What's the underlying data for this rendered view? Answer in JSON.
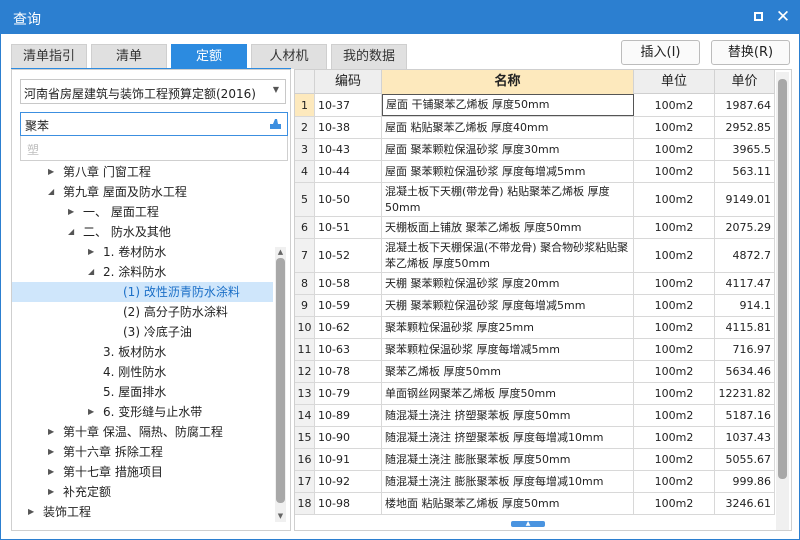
{
  "window": {
    "title": "查询"
  },
  "tabs": [
    {
      "label": "清单指引"
    },
    {
      "label": "清单"
    },
    {
      "label": "定额",
      "active": true
    },
    {
      "label": "人材机"
    },
    {
      "label": "我的数据"
    }
  ],
  "toolbar": {
    "insert_label": "插入(I)",
    "replace_label": "替换(R)"
  },
  "library": {
    "selected": "河南省房屋建筑与装饰工程预算定额(2016)"
  },
  "search": {
    "value": "聚苯",
    "suggestion": "塑"
  },
  "tree": [
    {
      "label": "第八章 门窗工程",
      "level": 0,
      "expanded": false
    },
    {
      "label": "第九章 屋面及防水工程",
      "level": 0,
      "expanded": true
    },
    {
      "label": "一、 屋面工程",
      "level": 1,
      "expanded": false
    },
    {
      "label": "二、 防水及其他",
      "level": 1,
      "expanded": true
    },
    {
      "label": "1. 卷材防水",
      "level": 2,
      "expanded": false
    },
    {
      "label": "2. 涂料防水",
      "level": 2,
      "expanded": true
    },
    {
      "label": "(1) 改性沥青防水涂料",
      "level": 3,
      "selected": true
    },
    {
      "label": "(2) 高分子防水涂料",
      "level": 3
    },
    {
      "label": "(3) 冷底子油",
      "level": 3
    },
    {
      "label": "3. 板材防水",
      "level": 2
    },
    {
      "label": "4. 刚性防水",
      "level": 2
    },
    {
      "label": "5. 屋面排水",
      "level": 2
    },
    {
      "label": "6. 变形缝与止水带",
      "level": 2,
      "expanded": false
    },
    {
      "label": "第十章 保温、隔热、防腐工程",
      "level": 0,
      "expanded": false
    },
    {
      "label": "第十六章 拆除工程",
      "level": 0,
      "expanded": false
    },
    {
      "label": "第十七章 措施项目",
      "level": 0,
      "expanded": false
    },
    {
      "label": "补充定额",
      "level": 0,
      "expanded": false
    },
    {
      "label": "装饰工程",
      "level": -1,
      "expanded": false
    }
  ],
  "grid": {
    "headers": {
      "code": "编码",
      "name": "名称",
      "unit": "单位",
      "price": "单价"
    },
    "rows": [
      {
        "no": "1",
        "code": "10-37",
        "name": "屋面 干铺聚苯乙烯板 厚度50mm",
        "unit": "100m2",
        "price": "1987.64"
      },
      {
        "no": "2",
        "code": "10-38",
        "name": "屋面 粘贴聚苯乙烯板 厚度40mm",
        "unit": "100m2",
        "price": "2952.85"
      },
      {
        "no": "3",
        "code": "10-43",
        "name": "屋面 聚苯颗粒保温砂浆 厚度30mm",
        "unit": "100m2",
        "price": "3965.5"
      },
      {
        "no": "4",
        "code": "10-44",
        "name": "屋面 聚苯颗粒保温砂浆 厚度每增减5mm",
        "unit": "100m2",
        "price": "563.11"
      },
      {
        "no": "5",
        "code": "10-50",
        "name": "混凝土板下天棚(带龙骨) 粘贴聚苯乙烯板 厚度50mm",
        "unit": "100m2",
        "price": "9149.01"
      },
      {
        "no": "6",
        "code": "10-51",
        "name": "天棚板面上铺放 聚苯乙烯板 厚度50mm",
        "unit": "100m2",
        "price": "2075.29"
      },
      {
        "no": "7",
        "code": "10-52",
        "name": "混凝土板下天棚保温(不带龙骨) 聚合物砂浆粘贴聚苯乙烯板 厚度50mm",
        "unit": "100m2",
        "price": "4872.7"
      },
      {
        "no": "8",
        "code": "10-58",
        "name": "天棚 聚苯颗粒保温砂浆 厚度20mm",
        "unit": "100m2",
        "price": "4117.47"
      },
      {
        "no": "9",
        "code": "10-59",
        "name": "天棚 聚苯颗粒保温砂浆 厚度每增减5mm",
        "unit": "100m2",
        "price": "914.1"
      },
      {
        "no": "10",
        "code": "10-62",
        "name": "聚苯颗粒保温砂浆 厚度25mm",
        "unit": "100m2",
        "price": "4115.81"
      },
      {
        "no": "11",
        "code": "10-63",
        "name": "聚苯颗粒保温砂浆 厚度每增减5mm",
        "unit": "100m2",
        "price": "716.97"
      },
      {
        "no": "12",
        "code": "10-78",
        "name": "聚苯乙烯板 厚度50mm",
        "unit": "100m2",
        "price": "5634.46"
      },
      {
        "no": "13",
        "code": "10-79",
        "name": "单面钢丝网聚苯乙烯板 厚度50mm",
        "unit": "100m2",
        "price": "12231.82"
      },
      {
        "no": "14",
        "code": "10-89",
        "name": "随混凝土浇注 挤塑聚苯板 厚度50mm",
        "unit": "100m2",
        "price": "5187.16"
      },
      {
        "no": "15",
        "code": "10-90",
        "name": "随混凝土浇注 挤塑聚苯板 厚度每增减10mm",
        "unit": "100m2",
        "price": "1037.43"
      },
      {
        "no": "16",
        "code": "10-91",
        "name": "随混凝土浇注 膨胀聚苯板 厚度50mm",
        "unit": "100m2",
        "price": "5055.67"
      },
      {
        "no": "17",
        "code": "10-92",
        "name": "随混凝土浇注 膨胀聚苯板 厚度每增减10mm",
        "unit": "100m2",
        "price": "999.86"
      },
      {
        "no": "18",
        "code": "10-98",
        "name": "楼地面 粘贴聚苯乙烯板 厚度50mm",
        "unit": "100m2",
        "price": "3246.61"
      }
    ]
  },
  "colors": {
    "accent": "#2c7fd0",
    "header_highlight": "#fde9bd",
    "selection": "#cfe6fb"
  }
}
